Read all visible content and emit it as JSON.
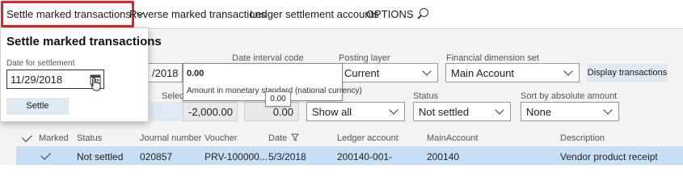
{
  "menu": {
    "settle_marked": "Settle marked transactions",
    "reverse_marked": "Reverse marked transactions",
    "ledger_accounts": "Ledger settlement accounts",
    "options": "OPTIONS"
  },
  "popup": {
    "title": "Settle marked transactions",
    "date_label": "Date for settlement",
    "date_value": "11/29/2018",
    "settle_button": "Settle"
  },
  "tooltip": {
    "value": "0.00",
    "description": "Amount in monetary standard (national currency)",
    "badge_value": "0.00"
  },
  "filters": {
    "date_partial": "/2018",
    "date_interval_label": "Date interval code",
    "posting_layer_label": "Posting layer",
    "posting_layer_value": "Current",
    "fin_dim_label": "Financial dimension set",
    "fin_dim_value": "Main Account",
    "display_button": "Display transactions",
    "selected_label": "Selecte",
    "selected_amount": "-2,000.00",
    "total_amount": "0.00",
    "show_value": "Show all",
    "status_label": "Status",
    "status_value": "Not settled",
    "sort_label": "Sort by absolute amount",
    "sort_value": "None"
  },
  "grid": {
    "headers": {
      "marked": "Marked",
      "status": "Status",
      "journal": "Journal number",
      "voucher": "Voucher",
      "date": "Date",
      "ledger": "Ledger account",
      "main_account": "MainAccount",
      "description": "Description"
    },
    "row": {
      "status": "Not settled",
      "journal": "020857",
      "voucher": "PRV-100000...",
      "date": "5/3/2018",
      "ledger": "200140-001-",
      "main_account": "200140",
      "description": "Vendor product receipt"
    }
  }
}
